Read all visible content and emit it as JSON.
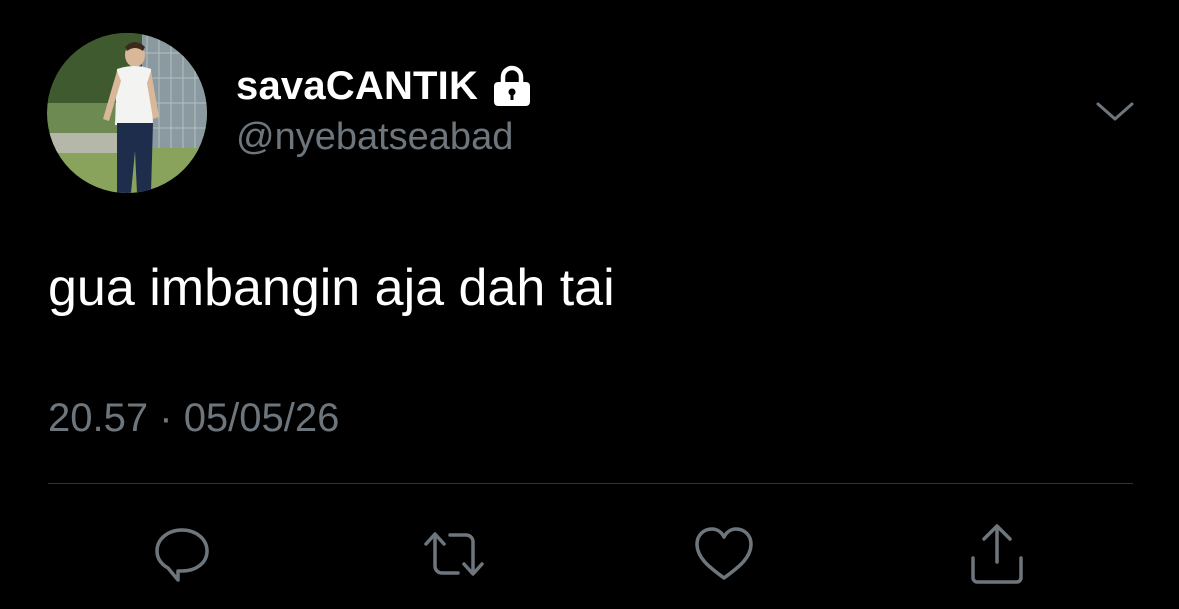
{
  "colors": {
    "background": "#000000",
    "primary_text": "#ffffff",
    "secondary_text": "#6e767d",
    "divider": "#2f3336",
    "icon": "#6e767d"
  },
  "tweet": {
    "author": {
      "display_name": "savaCANTIK",
      "handle": "@nyebatseabad",
      "protected_icon": "lock-icon",
      "avatar": "profile-photo"
    },
    "text": "gua imbangin aja dah tai",
    "time": "20.57",
    "separator": "·",
    "date": "05/05/26",
    "menu_icon": "chevron-down-icon"
  },
  "actions": [
    {
      "name": "reply",
      "icon": "speech-bubble-icon"
    },
    {
      "name": "retweet",
      "icon": "retweet-icon"
    },
    {
      "name": "like",
      "icon": "heart-icon"
    },
    {
      "name": "share",
      "icon": "share-icon"
    }
  ]
}
